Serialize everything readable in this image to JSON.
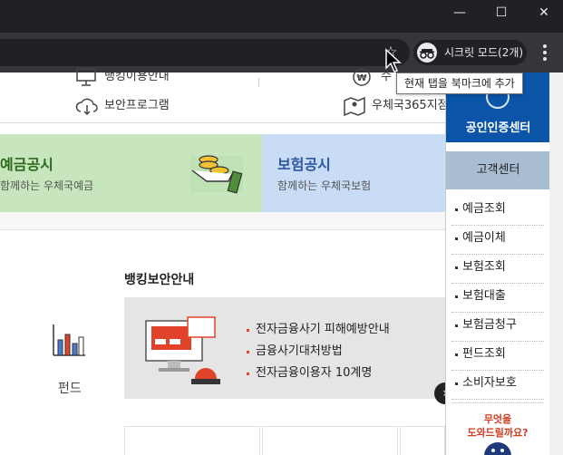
{
  "window": {
    "minimize_icon": "minimize-icon",
    "maximize_icon": "maximize-icon",
    "close_icon": "close-icon"
  },
  "toolbar": {
    "incognito_label": "시크릿 모드(2개)",
    "bookmark_tooltip": "현재 탭을 북마크에 추가"
  },
  "util": {
    "banking_guide": "뱅킹이용안내",
    "security_program": "보안프로그램",
    "exchange_partial": "수",
    "post_office_365": "우체국365지점"
  },
  "banners": {
    "deposit_title": "예금공시",
    "deposit_sub": "함께하는 우체국예금",
    "insurance_title": "보험공시",
    "insurance_sub": "함께하는 우체국보험"
  },
  "content": {
    "fund_label": "펀드",
    "security_title": "뱅킹보안안내",
    "security_items": [
      "전자금융사기 피해예방안내",
      "금융사기대처방법",
      "전자금융이용자 10계명"
    ]
  },
  "quick_menu": {
    "cert_center": "공인인증센터",
    "customer_center": "고객센터",
    "items": [
      "예금조회",
      "예금이체",
      "보험조회",
      "보험대출",
      "보험금청구",
      "펀드조회",
      "소비자보호"
    ],
    "help_line1": "무엇을",
    "help_line2": "도와드릴까요?"
  },
  "colors": {
    "deposit_banner": "#c7e6bd",
    "insurance_banner": "#c9dcf6",
    "quick_header": "#0b54a8",
    "quick_sub": "#a9bdd2",
    "accent_red": "#e0432a"
  }
}
